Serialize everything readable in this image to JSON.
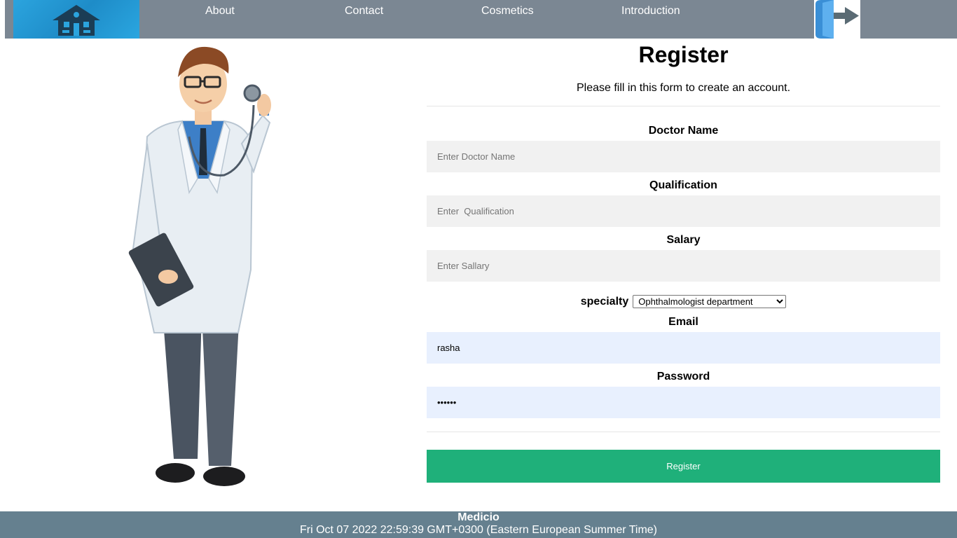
{
  "nav": {
    "links": [
      "About",
      "Contact",
      "Cosmetics",
      "Introduction"
    ],
    "logo_icon": "home-icon",
    "logout_icon": "logout-icon"
  },
  "form": {
    "title": "Register",
    "subtitle": "Please fill in this form to create an account.",
    "doctor_name_label": "Doctor Name",
    "doctor_name_placeholder": "Enter Doctor Name",
    "doctor_name_value": "",
    "qualification_label": "Qualification",
    "qualification_placeholder": "Enter  Qualification",
    "qualification_value": "",
    "salary_label": "Salary",
    "salary_placeholder": "Enter Sallary",
    "salary_value": "",
    "specialty_label": "specialty",
    "specialty_selected": "Ophthalmologist department",
    "email_label": "Email",
    "email_value": "rasha",
    "password_label": "Password",
    "password_value": "123456",
    "register_label": "Register"
  },
  "footer": {
    "brand": "Medicio",
    "datetime": "Fri Oct 07 2022 22:59:39 GMT+0300 (Eastern European Summer Time)"
  },
  "colors": {
    "nav_bg": "#7b8793",
    "footer_bg": "#65808f",
    "button_bg": "#1fb07a",
    "autofill_bg": "#e8f0fe",
    "input_bg": "#f1f1f1"
  }
}
